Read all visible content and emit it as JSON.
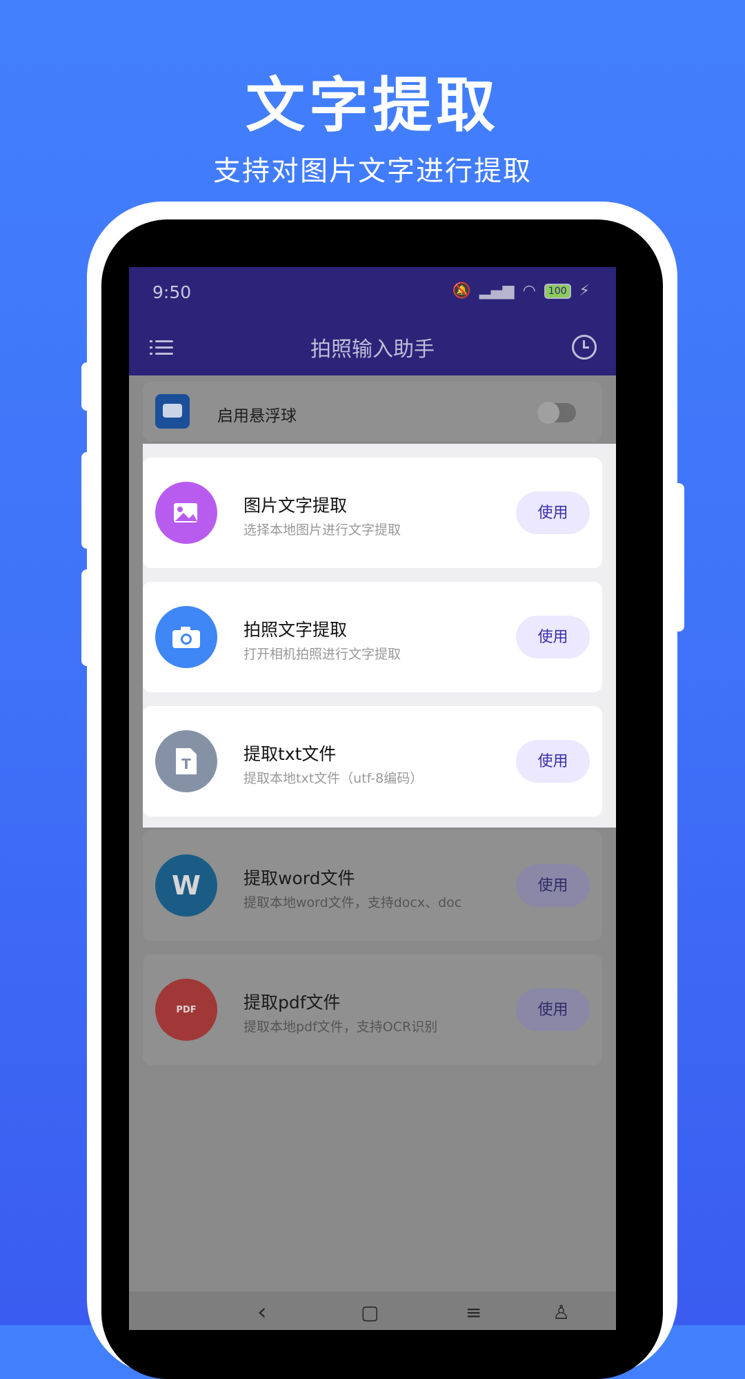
{
  "promo": {
    "title": "文字提取",
    "subtitle": "支持对图片文字进行提取"
  },
  "statusbar": {
    "time": "9:50",
    "battery": "100"
  },
  "appbar": {
    "title": "拍照输入助手",
    "menu_icon": "menu-icon",
    "history_icon": "clock-icon"
  },
  "floating_ball": {
    "label": "启用悬浮球",
    "enabled": false
  },
  "features": [
    {
      "title": "图片文字提取",
      "desc": "选择本地图片进行文字提取",
      "button": "使用",
      "icon": "image-icon",
      "color": "#b85cf0"
    },
    {
      "title": "拍照文字提取",
      "desc": "打开相机拍照进行文字提取",
      "button": "使用",
      "icon": "camera-icon",
      "color": "#3f86f6"
    },
    {
      "title": "提取txt文件",
      "desc": "提取本地txt文件（utf-8编码）",
      "button": "使用",
      "icon": "txt-file-icon",
      "color": "#8592a6"
    },
    {
      "title": "提取word文件",
      "desc": "提取本地word文件，支持docx、doc",
      "button": "使用",
      "icon": "word-icon",
      "color": "#1a5c86",
      "icon_text": "W"
    },
    {
      "title": "提取pdf文件",
      "desc": "提取本地pdf文件，支持OCR识别",
      "button": "使用",
      "icon": "pdf-icon",
      "color": "#a03838",
      "icon_text": "PDF"
    }
  ]
}
